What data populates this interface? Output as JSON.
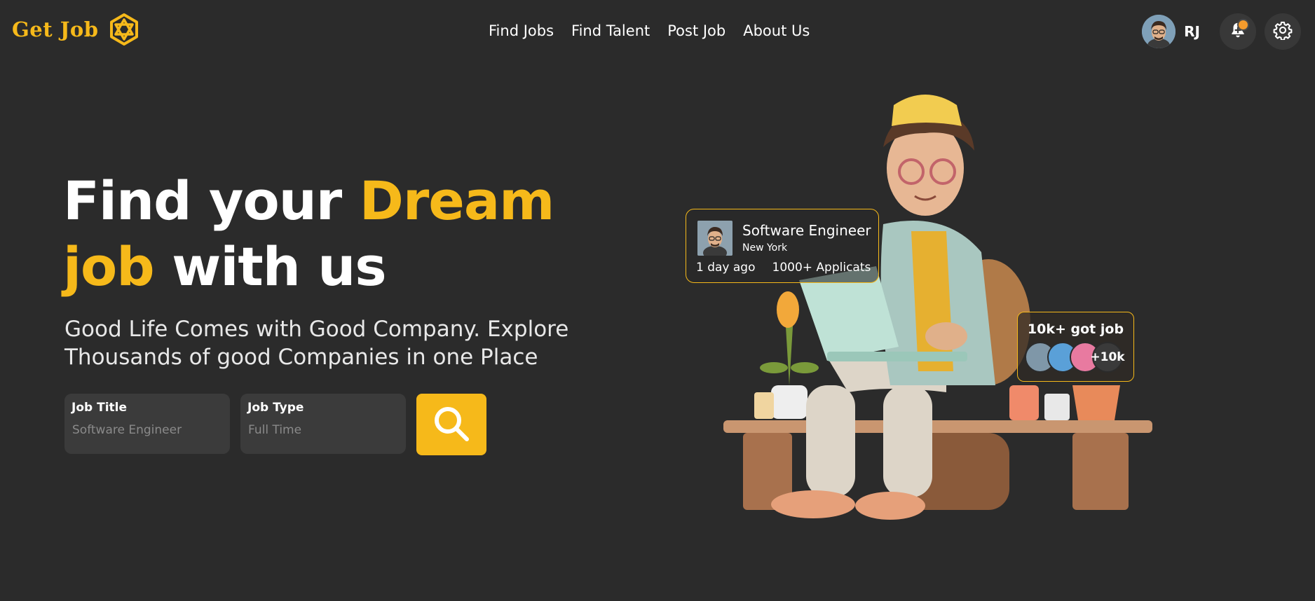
{
  "logo": {
    "text": "Get Job",
    "icon": "hexagon-network-icon",
    "color": "#f6b91a"
  },
  "nav": {
    "items": [
      {
        "label": "Find Jobs"
      },
      {
        "label": "Find Talent"
      },
      {
        "label": "Post Job"
      },
      {
        "label": "About Us"
      }
    ]
  },
  "user": {
    "initials": "RJ",
    "notification_icon": "bell-icon",
    "settings_icon": "gear-icon"
  },
  "hero": {
    "headline_part1": "Find your ",
    "headline_accent1": "Dream",
    "headline_accent2": "job",
    "headline_part2": " with us",
    "subtitle": "Good Life Comes with Good Company. Explore Thousands of good Companies in one Place"
  },
  "search": {
    "job_title_label": "Job Title",
    "job_title_placeholder": "Software Engineer",
    "job_type_label": "Job Type",
    "job_type_placeholder": "Full Time",
    "button_icon": "search-icon"
  },
  "job_card": {
    "title": "Software Engineer",
    "location": "New York",
    "posted": "1 day ago",
    "applicants": "1000+ Applicats"
  },
  "stats_card": {
    "title": "10k+ got job",
    "more": "+10k"
  },
  "colors": {
    "background": "#2b2b2b",
    "accent": "#f6b91a",
    "notification": "#f59b2c"
  }
}
